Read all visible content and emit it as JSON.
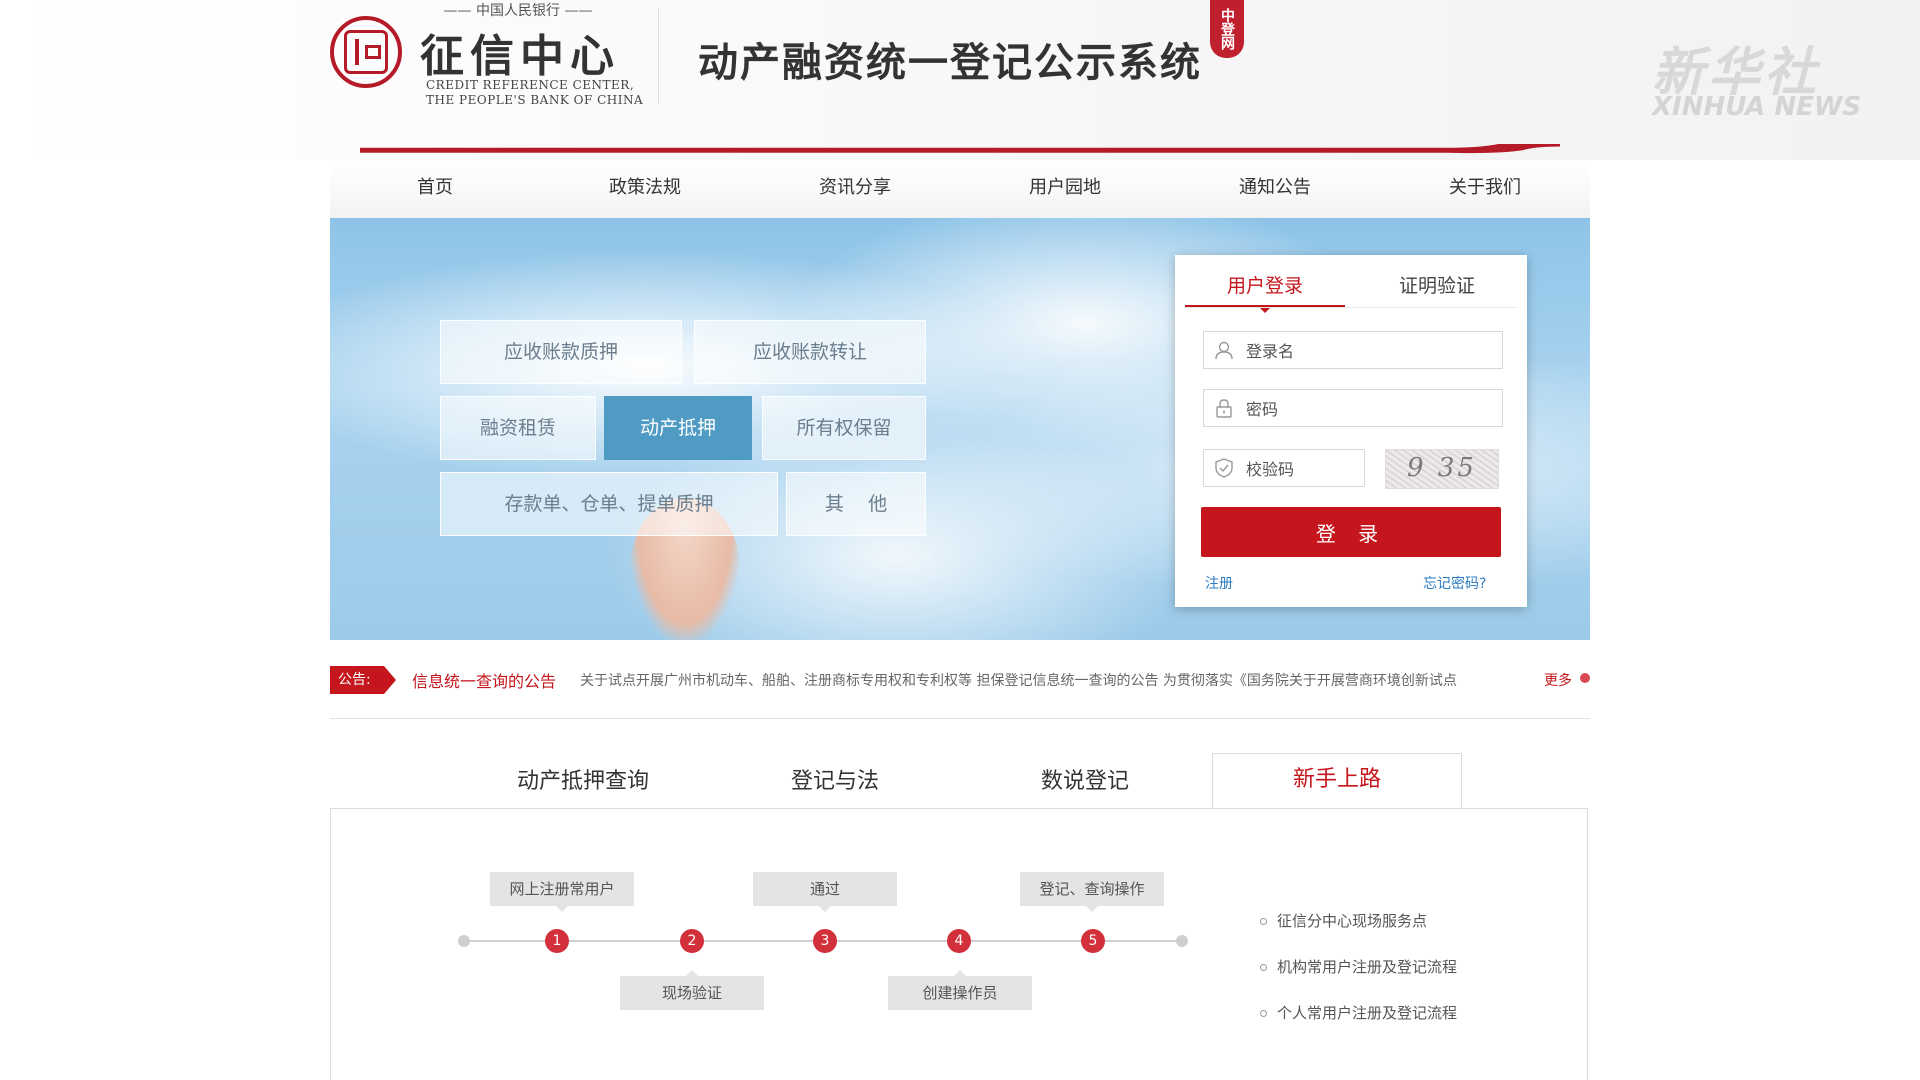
{
  "header": {
    "bank_name": "—— 中国人民银行 ——",
    "brand_name": "征信中心",
    "brand_en_line1": "CREDIT REFERENCE CENTER,",
    "brand_en_line2": "THE PEOPLE'S BANK OF CHINA",
    "system_title": "动产融资统一登记公示系统",
    "badge_text": "中登网",
    "watermark_cn": "新华社",
    "watermark_en": "XINHUA NEWS"
  },
  "nav": {
    "items": [
      "首页",
      "政策法规",
      "资讯分享",
      "用户园地",
      "通知公告",
      "关于我们"
    ]
  },
  "banner": {
    "categories": {
      "receivables_pledge": "应收账款质押",
      "receivables_transfer": "应收账款转让",
      "financial_lease": "融资租赁",
      "chattel_mortgage": "动产抵押",
      "retention_of_title": "所有权保留",
      "deposit_pledge": "存款单、仓单、提单质押",
      "other": "其    他"
    }
  },
  "login": {
    "tab_user_login": "用户登录",
    "tab_cert_verify": "证明验证",
    "username_placeholder": "登录名",
    "password_placeholder": "密码",
    "captcha_placeholder": "校验码",
    "captcha_text": "9 35",
    "login_button": "登 录",
    "register_link": "注册",
    "forgot_link": "忘记密码?"
  },
  "notice": {
    "badge": "公告:",
    "title": "信息统一查询的公告",
    "text": "关于试点开展广州市机动车、船舶、注册商标专用权和专利权等 担保登记信息统一查询的公告 为贯彻落实《国务院关于开展营商环境创新试点",
    "more": "更多"
  },
  "content_tabs": [
    "动产抵押查询",
    "登记与法",
    "数说登记",
    "新手上路"
  ],
  "flow": {
    "steps": [
      "1",
      "2",
      "3",
      "4",
      "5"
    ],
    "labels_up": [
      "网上注册常用户",
      "通过",
      "登记、查询操作"
    ],
    "labels_down": [
      "现场验证",
      "创建操作员"
    ]
  },
  "guide_links": [
    "征信分中心现场服务点",
    "机构常用户注册及登记流程",
    "个人常用户注册及登记流程"
  ],
  "colors": {
    "brand_red": "#c4161c",
    "active_tile_blue": "#4f9bc4",
    "link_blue": "#2b7bc1"
  }
}
